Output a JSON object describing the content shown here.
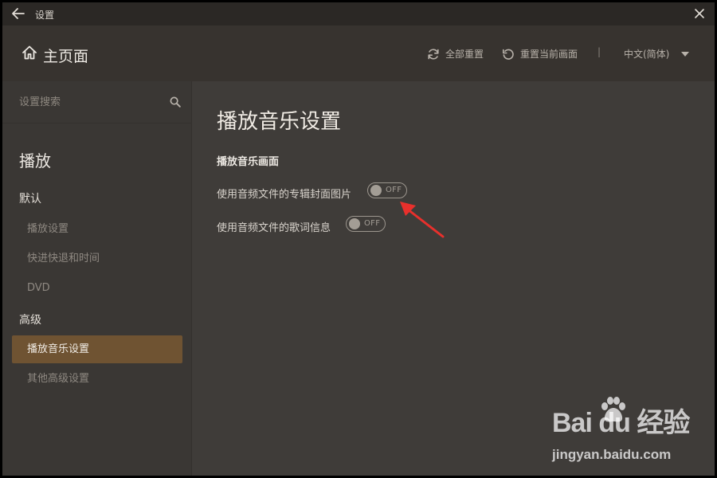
{
  "window": {
    "title": "设置"
  },
  "header": {
    "home_label": "主页面",
    "reset_all": "全部重置",
    "reset_current": "重置当前画面",
    "separator": "|",
    "language": "中文(简体)"
  },
  "sidebar": {
    "search_placeholder": "设置搜索",
    "section_title": "播放",
    "groups": [
      {
        "label": "默认",
        "items": [
          "播放设置",
          "快进快退和时间",
          "DVD"
        ]
      },
      {
        "label": "高级",
        "items": [
          "播放音乐设置",
          "其他高级设置"
        ]
      }
    ],
    "active_item": "播放音乐设置"
  },
  "main": {
    "title": "播放音乐设置",
    "subsection": "播放音乐画面",
    "options": [
      {
        "label": "使用音频文件的专辑封面图片",
        "state": "OFF"
      },
      {
        "label": "使用音频文件的歌词信息",
        "state": "OFF"
      }
    ]
  },
  "colors": {
    "accent_active": "#6f5332",
    "annotation_arrow": "#e8302c"
  },
  "watermark": {
    "logo_text": "Bai  du 经验",
    "url": "jingyan.baidu.com"
  }
}
